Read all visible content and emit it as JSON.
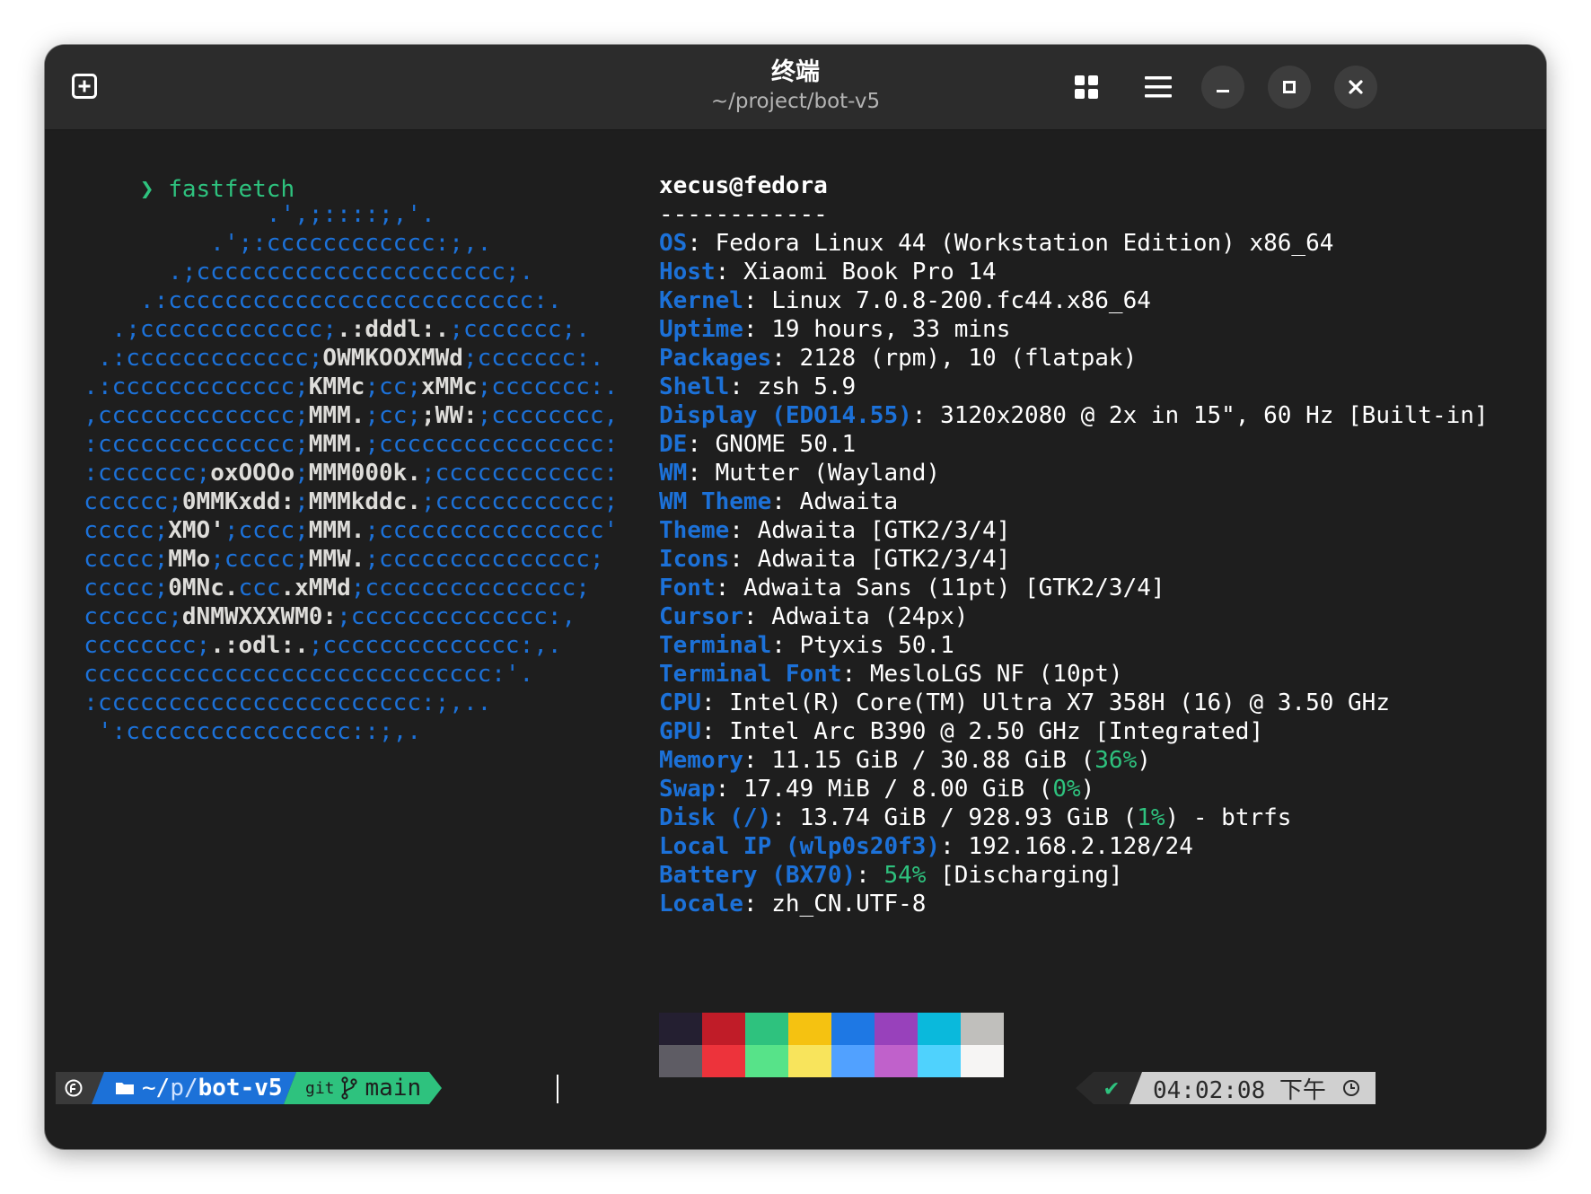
{
  "window": {
    "title": "终端",
    "subtitle": "~/project/bot-v5",
    "icons": {
      "new_tab": "new-tab-icon",
      "tab_overview": "tab-overview-icon",
      "menu": "hamburger-menu-icon",
      "minimize": "minimize-icon",
      "maximize": "maximize-icon",
      "close": "close-icon"
    }
  },
  "colors": {
    "logo_blue": "#1c71d8",
    "key_blue": "#1c71d8",
    "green": "#2ec27e",
    "text": "#ffffff",
    "background": "#1e1e1e",
    "titlebar": "#2c2c2c"
  },
  "prompt": {
    "symbol": "❯",
    "command": "fastfetch"
  },
  "logo_lines": [
    [
      [
        "b",
        "               .',;::::;,'."
      ]
    ],
    [
      [
        "b",
        "           .';:cccccccccccc:;,."
      ]
    ],
    [
      [
        "b",
        "        .;cccccccccccccccccccccc;."
      ]
    ],
    [
      [
        "b",
        "      .:cccccccccccccccccccccccccc:."
      ]
    ],
    [
      [
        "b",
        "    .;ccccccccccccc;"
      ],
      [
        "w",
        ".:dddl:."
      ],
      [
        "b",
        ";ccccccc;."
      ]
    ],
    [
      [
        "b",
        "   .:ccccccccccccc;"
      ],
      [
        "w",
        "OWMKOOXMWd"
      ],
      [
        "b",
        ";ccccccc:."
      ]
    ],
    [
      [
        "b",
        "  .:ccccccccccccc;"
      ],
      [
        "w",
        "KMMc"
      ],
      [
        "b",
        ";cc;"
      ],
      [
        "w",
        "xMMc"
      ],
      [
        "b",
        ";ccccccc:."
      ]
    ],
    [
      [
        "b",
        "  ,cccccccccccccc;"
      ],
      [
        "w",
        "MMM."
      ],
      [
        "b",
        ";cc;"
      ],
      [
        "w",
        ";WW:"
      ],
      [
        "b",
        ";cccccccc,"
      ]
    ],
    [
      [
        "b",
        "  :cccccccccccccc;"
      ],
      [
        "w",
        "MMM."
      ],
      [
        "b",
        ";cccccccccccccccc:"
      ]
    ],
    [
      [
        "b",
        "  :ccccccc;"
      ],
      [
        "w",
        "oxOOOo"
      ],
      [
        "b",
        ";"
      ],
      [
        "w",
        "MMM000k."
      ],
      [
        "b",
        ";cccccccccccc:"
      ]
    ],
    [
      [
        "b",
        "  cccccc;"
      ],
      [
        "w",
        "0MMKxdd:"
      ],
      [
        "b",
        ";"
      ],
      [
        "w",
        "MMMkddc."
      ],
      [
        "b",
        ";cccccccccccc;"
      ]
    ],
    [
      [
        "b",
        "  ccccc;"
      ],
      [
        "w",
        "XMO'"
      ],
      [
        "b",
        ";cccc;"
      ],
      [
        "w",
        "MMM."
      ],
      [
        "b",
        ";cccccccccccccccc'"
      ]
    ],
    [
      [
        "b",
        "  ccccc;"
      ],
      [
        "w",
        "MMo"
      ],
      [
        "b",
        ";ccccc;"
      ],
      [
        "w",
        "MMW."
      ],
      [
        "b",
        ";ccccccccccccccc;"
      ]
    ],
    [
      [
        "b",
        "  ccccc;"
      ],
      [
        "w",
        "0MNc."
      ],
      [
        "b",
        "ccc"
      ],
      [
        "w",
        ".xMMd"
      ],
      [
        "b",
        ";ccccccccccccccc;"
      ]
    ],
    [
      [
        "b",
        "  cccccc;"
      ],
      [
        "w",
        "dNMWXXXWM0:"
      ],
      [
        "b",
        ";cccccccccccccc:,"
      ]
    ],
    [
      [
        "b",
        "  cccccccc;"
      ],
      [
        "w",
        ".:odl:."
      ],
      [
        "b",
        ";cccccccccccccc:,."
      ]
    ],
    [
      [
        "b",
        "  ccccccccccccccccccccccccccccc:'."
      ]
    ],
    [
      [
        "b",
        "  :ccccccccccccccccccccccc:;,.."
      ]
    ],
    [
      [
        "b",
        "   ':cccccccccccccccc::;,."
      ]
    ]
  ],
  "info": {
    "user_host": "xecus@fedora",
    "separator": "------------",
    "rows": [
      {
        "key": "OS",
        "value": "Fedora Linux 44 (Workstation Edition) x86_64"
      },
      {
        "key": "Host",
        "value": "Xiaomi Book Pro 14"
      },
      {
        "key": "Kernel",
        "value": "Linux 7.0.8-200.fc44.x86_64"
      },
      {
        "key": "Uptime",
        "value": "19 hours, 33 mins"
      },
      {
        "key": "Packages",
        "value": "2128 (rpm), 10 (flatpak)"
      },
      {
        "key": "Shell",
        "value": "zsh 5.9"
      },
      {
        "key": "Display (EDO14.55)",
        "value": "3120x2080 @ 2x in 15\", 60 Hz [Built-in]"
      },
      {
        "key": "DE",
        "value": "GNOME 50.1"
      },
      {
        "key": "WM",
        "value": "Mutter (Wayland)"
      },
      {
        "key": "WM Theme",
        "value": "Adwaita"
      },
      {
        "key": "Theme",
        "value": "Adwaita [GTK2/3/4]"
      },
      {
        "key": "Icons",
        "value": "Adwaita [GTK2/3/4]"
      },
      {
        "key": "Font",
        "value": "Adwaita Sans (11pt) [GTK2/3/4]"
      },
      {
        "key": "Cursor",
        "value": "Adwaita (24px)"
      },
      {
        "key": "Terminal",
        "value": "Ptyxis 50.1"
      },
      {
        "key": "Terminal Font",
        "value": "MesloLGS NF (10pt)"
      },
      {
        "key": "CPU",
        "value": "Intel(R) Core(TM) Ultra X7 358H (16) @ 3.50 GHz"
      },
      {
        "key": "GPU",
        "value": "Intel Arc B390 @ 2.50 GHz [Integrated]"
      },
      {
        "key": "Memory",
        "value": "11.15 GiB / 30.88 GiB (",
        "pct": "36%",
        "tail": ")"
      },
      {
        "key": "Swap",
        "value": "17.49 MiB / 8.00 GiB (",
        "pct": "0%",
        "tail": ")"
      },
      {
        "key": "Disk (/)",
        "value": "13.74 GiB / 928.93 GiB (",
        "pct": "1%",
        "tail": ") - btrfs"
      },
      {
        "key": "Local IP (wlp0s20f3)",
        "value": "192.168.2.128/24"
      },
      {
        "key": "Battery (BX70)",
        "value": "",
        "pct": "54%",
        "tail": " [Discharging]"
      },
      {
        "key": "Locale",
        "value": "zh_CN.UTF-8"
      }
    ]
  },
  "palette": {
    "top": [
      "#241f31",
      "#c01c28",
      "#2ec27e",
      "#f5c211",
      "#1e78e4",
      "#9841bb",
      "#0ab9dc",
      "#c0bfbc"
    ],
    "bottom": [
      "#5e5c64",
      "#ed333b",
      "#57e389",
      "#f8e45c",
      "#51a1ff",
      "#c061cb",
      "#4fd2fd",
      "#f6f5f4"
    ]
  },
  "statusbar": {
    "os_icon": "fedora-icon",
    "folder_icon": "folder-icon",
    "path_prefix": "~/",
    "path_mid": "p/",
    "path_name": "bot-v5",
    "git_label": "git",
    "branch_icon": "git-branch-icon",
    "branch": "main",
    "check_icon": "checkmark-icon",
    "check": "✔",
    "time": "04:02:08 下午",
    "clock_icon": "clock-icon",
    "colors": {
      "os_bg": "#3a3a3a",
      "path_bg": "#1c71d8",
      "git_bg": "#2ec27e",
      "status_bg": "#3a3a3a",
      "time_bg": "#d0d0d0"
    }
  }
}
